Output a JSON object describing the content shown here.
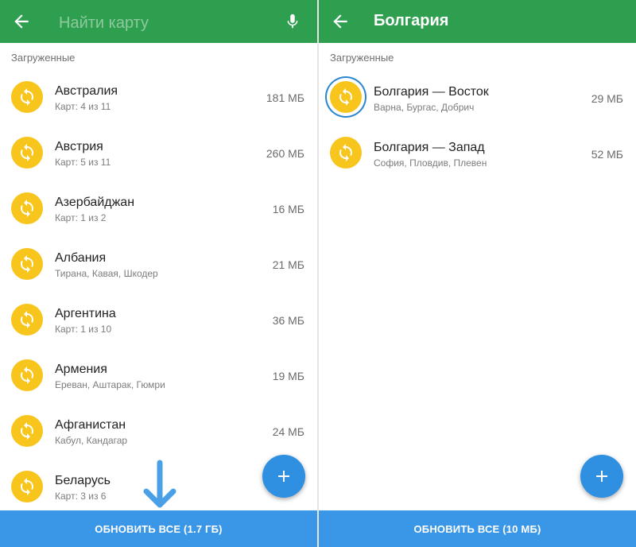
{
  "left": {
    "search_placeholder": "Найти карту",
    "section_title": "Загруженные",
    "items": [
      {
        "name": "Австралия",
        "sub": "Карт: 4 из 11",
        "size": "181 МБ"
      },
      {
        "name": "Австрия",
        "sub": "Карт: 5 из 11",
        "size": "260 МБ"
      },
      {
        "name": "Азербайджан",
        "sub": "Карт: 1 из 2",
        "size": "16 МБ"
      },
      {
        "name": "Албания",
        "sub": "Тирана, Кавая, Шкодер",
        "size": "21 МБ"
      },
      {
        "name": "Аргентина",
        "sub": "Карт: 1 из 10",
        "size": "36 МБ"
      },
      {
        "name": "Армения",
        "sub": "Ереван, Аштарак, Гюмри",
        "size": "19 МБ"
      },
      {
        "name": "Афганистан",
        "sub": "Кабул, Кандагар",
        "size": "24 МБ"
      },
      {
        "name": "Беларусь",
        "sub": "Карт: 3 из 6",
        "size": ""
      }
    ],
    "update_all_label": "ОБНОВИТЬ ВСЕ (1.7 ГБ)"
  },
  "right": {
    "title": "Болгария",
    "section_title": "Загруженные",
    "items": [
      {
        "name": "Болгария — Восток",
        "sub": "Варна, Бургас, Добрич",
        "size": "29 МБ"
      },
      {
        "name": "Болгария — Запад",
        "sub": "София, Пловдив, Плевен",
        "size": "52 МБ"
      }
    ],
    "update_all_label": "ОБНОВИТЬ ВСЕ (10 МБ)"
  },
  "icons": {
    "back": "arrow-left-icon",
    "mic": "microphone-icon",
    "update": "refresh-icon",
    "add": "plus-icon",
    "annotation": "down-arrow-icon"
  },
  "colors": {
    "header": "#2e9e4f",
    "update_icon": "#f7c51c",
    "fab": "#2f8fe0",
    "bottom_button": "#3a97e8",
    "highlight_border": "#2a86cf"
  }
}
